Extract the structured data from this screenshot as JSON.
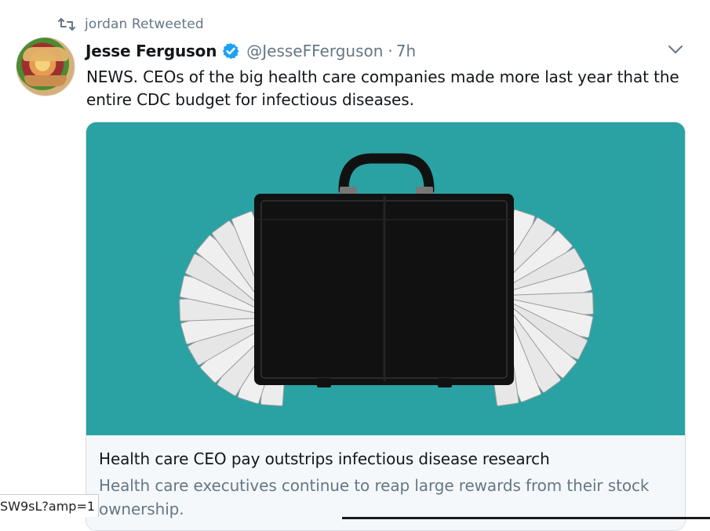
{
  "retweet": {
    "label": "jordan Retweeted",
    "icon": "retweet-icon"
  },
  "author": {
    "display_name": "Jesse Ferguson",
    "verified": true,
    "handle": "@JesseFFerguson",
    "separator": "·",
    "time": "7h"
  },
  "tweet": {
    "text": "NEWS. CEOs of the big health care companies made more last year that the entire CDC budget for infectious diseases."
  },
  "card": {
    "title": "Health care CEO pay outstrips infectious disease research",
    "description": "Health care executives continue to reap large rewards from their stock ownership."
  },
  "status_bar": {
    "url_text": "SW9sL?amp=1"
  },
  "colors": {
    "card_background": "#2aa2a4",
    "briefcase": "#111111",
    "money": "#ebebeb",
    "verified": "#1da1f2",
    "muted_text": "#657786"
  }
}
